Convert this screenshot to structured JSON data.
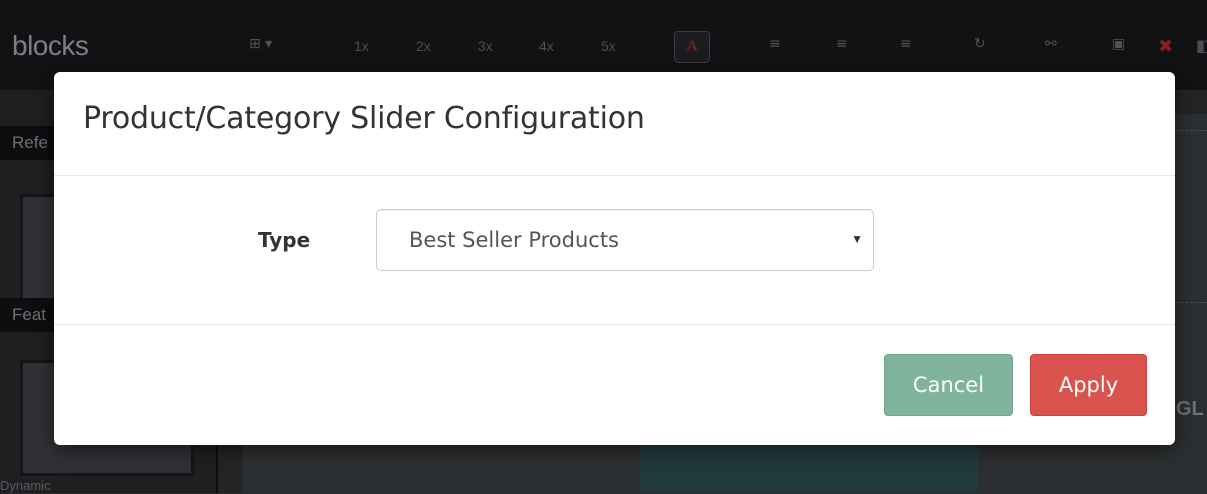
{
  "background": {
    "brand": "blocks",
    "toolbar": {
      "zoom_levels": [
        "1x",
        "2x",
        "3x",
        "4x",
        "5x"
      ],
      "color_button_label": "A"
    },
    "sidebar": {
      "headers": [
        "Refe",
        "Feat"
      ],
      "caption": "Dynamic"
    },
    "main_fragment": "GL"
  },
  "modal": {
    "title": "Product/Category Slider Configuration",
    "type_label": "Type",
    "type_select": {
      "value": "Best Seller Products"
    },
    "buttons": {
      "cancel": "Cancel",
      "apply": "Apply"
    }
  },
  "colors": {
    "cancel_button": "#7fb39b",
    "apply_button": "#d9534f",
    "close_icon": "#8b1d1d"
  }
}
